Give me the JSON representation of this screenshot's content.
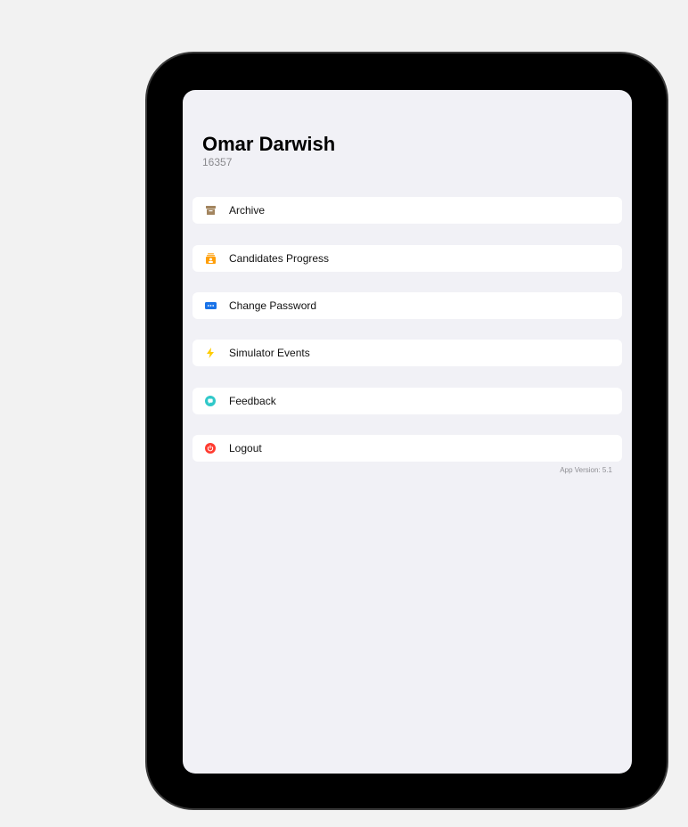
{
  "profile": {
    "name": "Omar Darwish",
    "id": "16357"
  },
  "menu": [
    {
      "label": "Archive",
      "icon": "archive-box-icon",
      "color": "#a2845e"
    },
    {
      "label": "Candidates Progress",
      "icon": "candidates-icon",
      "color": "#ff9f0a"
    },
    {
      "label": "Change Password",
      "icon": "password-icon",
      "color": "#1a73e8"
    },
    {
      "label": "Simulator Events",
      "icon": "lightning-icon",
      "color": "#ffcc00"
    },
    {
      "label": "Feedback",
      "icon": "feedback-bubble-icon",
      "color": "#30c8c9"
    },
    {
      "label": "Logout",
      "icon": "power-icon",
      "color": "#ff3b30"
    }
  ],
  "footer": {
    "version": "App Version: 5.1"
  }
}
